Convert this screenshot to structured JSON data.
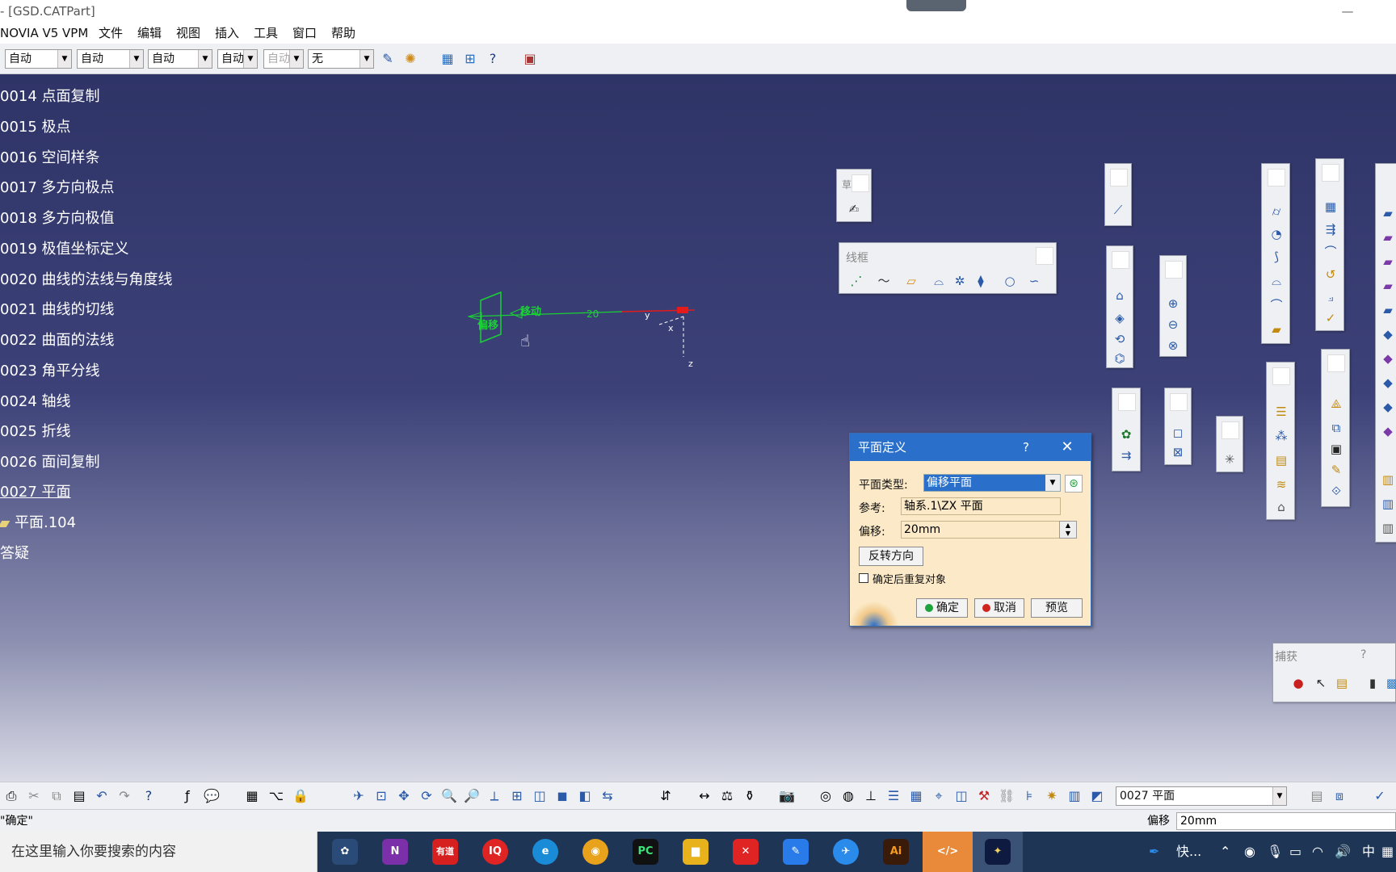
{
  "window": {
    "title": "- [GSD.CATPart]",
    "minimize": "—"
  },
  "menu": [
    "NOVIA V5 VPM",
    "文件",
    "编辑",
    "视图",
    "插入",
    "工具",
    "窗口",
    "帮助"
  ],
  "toolbar": {
    "combos": [
      "自动",
      "自动",
      "自动",
      "自动",
      "自动",
      "无"
    ],
    "icons": [
      "brush-icon",
      "palette-icon",
      "sketch-icon",
      "grid-icon",
      "help-icon",
      "material-icon"
    ]
  },
  "tree": [
    "0014 点面复制",
    "0015 极点",
    "0016 空间样条",
    "0017 多方向极点",
    "0018 多方向极值",
    "0019 极值坐标定义",
    "0020 曲线的法线与角度线",
    "0021 曲线的切线",
    "0022 曲面的法线",
    "0023  角平分线",
    "0024 轴线",
    "0025 折线",
    "0026 面间复制",
    "0027 平面",
    "平面.104",
    "答疑"
  ],
  "model": {
    "offset_label": "偏移",
    "move_label": "移动",
    "dimension": "20",
    "axis_x": "x",
    "axis_y": "y",
    "axis_z": "z"
  },
  "panels": {
    "wireframe_title": "线框",
    "sketch_title": "草",
    "snap_title": "捕获",
    "snap_help": "?"
  },
  "dialog": {
    "title": "平面定义",
    "help": "?",
    "close": "✕",
    "type_label": "平面类型:",
    "type_value": "偏移平面",
    "ref_label": "参考:",
    "ref_value": "轴系.1\\ZX 平面",
    "offset_label": "偏移:",
    "offset_value": "20mm",
    "reverse_button": "反转方向",
    "repeat_checkbox": "确定后重复对象",
    "ok": "确定",
    "cancel": "取消",
    "preview": "预览"
  },
  "bottom_toolbar": {
    "current_item": "0027 平面"
  },
  "status": {
    "message": "\"确定\"",
    "offset_label": "偏移",
    "offset_value": "20mm"
  },
  "taskbar": {
    "search_placeholder": "在这里输入你要搜索的内容",
    "apps": [
      "N",
      "有道",
      "IQ",
      "e",
      "◉",
      "PC",
      "▆",
      "✕",
      "✎",
      "✈",
      "Ai",
      "</>",
      "✦"
    ],
    "tray_text": "快...",
    "ime": "中"
  },
  "colors": {
    "viewport_top": "#2f3467",
    "dialog_bg": "#fbe9c7",
    "dialog_title": "#2a6fc9",
    "model_green": "#19d233",
    "model_red": "#e31b1b",
    "taskbar": "#1e3556"
  }
}
